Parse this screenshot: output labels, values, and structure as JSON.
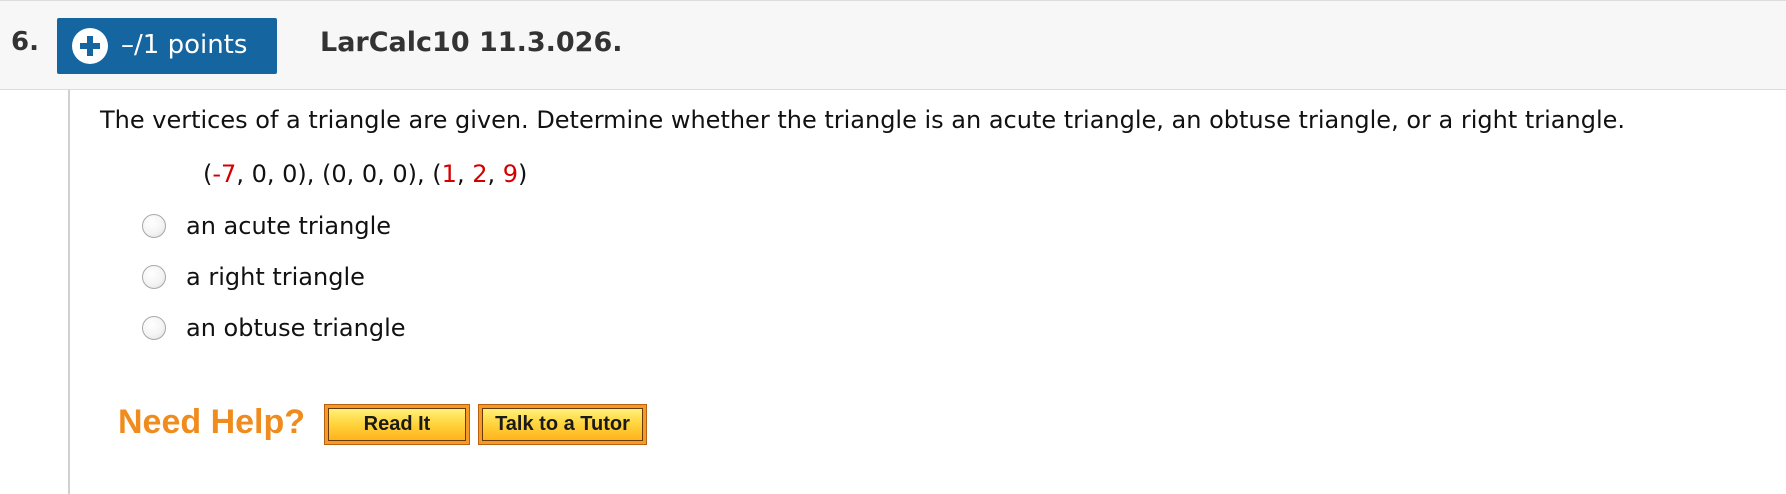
{
  "header": {
    "question_number": "6.",
    "points_label": "–/1 points",
    "assignment_id": "LarCalc10 11.3.026."
  },
  "question": {
    "text": "The vertices of a triangle are given. Determine whether the triangle is an acute triangle, an obtuse triangle, or a right triangle.",
    "vertices": {
      "open1": "(",
      "v1_x": "-7",
      "v1_rest": ", 0, 0), (0, 0, 0), (",
      "v3_x": "1",
      "sep1": ", ",
      "v3_y": "2",
      "sep2": ", ",
      "v3_z": "9",
      "close": ")"
    }
  },
  "options": [
    {
      "label": "an acute triangle",
      "selected": false
    },
    {
      "label": "a right triangle",
      "selected": false
    },
    {
      "label": "an obtuse triangle",
      "selected": false
    }
  ],
  "help": {
    "label": "Need Help?",
    "read_it": "Read It",
    "talk_to_tutor": "Talk to a Tutor"
  },
  "colors": {
    "points_button": "#1565a0",
    "highlight_red": "#d40000",
    "need_help_orange": "#f08c1e",
    "help_button": "#ffd640"
  },
  "icons": {
    "points_button_icon": "plus-circle-icon"
  }
}
